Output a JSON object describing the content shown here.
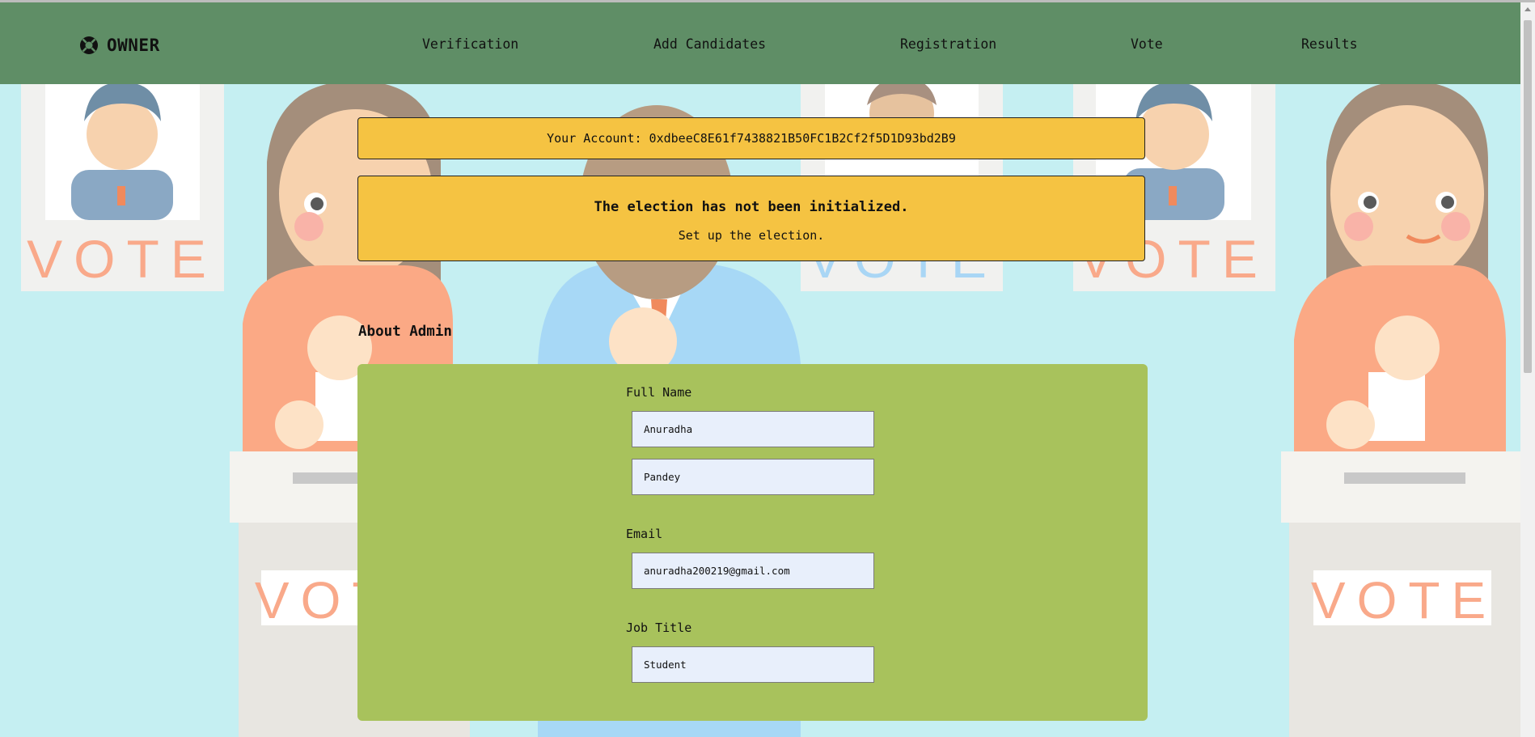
{
  "navbar": {
    "brand": "OWNER",
    "brand_icon": "lifebuoy-icon",
    "links": [
      "Verification",
      "Add Candidates",
      "Registration",
      "Vote",
      "Results"
    ]
  },
  "account": {
    "text": "Your Account: 0xdbeeC8E61f7438821B50FC1B2Cf2f5D1D93bd2B9"
  },
  "notice": {
    "title": "The election has not been initialized.",
    "subtitle": "Set up the election."
  },
  "about_admin": {
    "title": "About Admin",
    "full_name_label": "Full Name",
    "first_name": "Anuradha",
    "last_name": "Pandey",
    "email_label": "Email",
    "email": "anuradha200219@gmail.com",
    "job_title_label": "Job Title",
    "job_title": "Student"
  },
  "background": {
    "poster_text": "VOTE",
    "ballot_box_text": "VOTE"
  },
  "colors": {
    "navbar": "#5f8e66",
    "page_bg": "#c5eff2",
    "notice_bg": "#f5c342",
    "form_card": "#a8c25c",
    "input_bg": "#e8effb"
  }
}
